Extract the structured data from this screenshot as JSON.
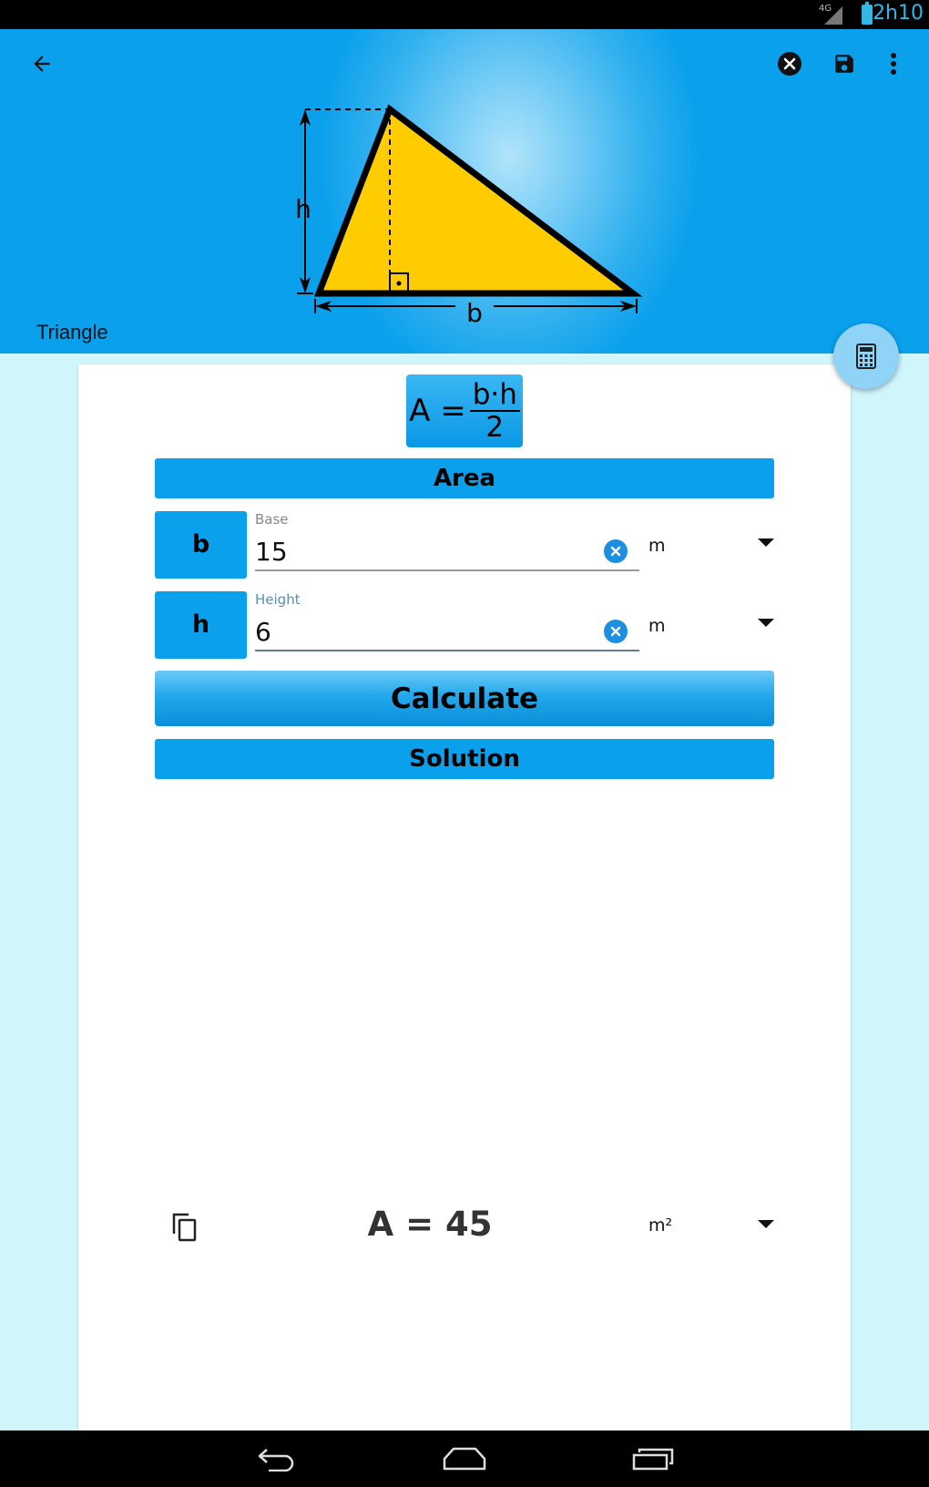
{
  "status_bar": {
    "network_label": "4G",
    "time": "2h10"
  },
  "header": {
    "title": "Triangle",
    "icons": [
      "back-arrow-icon",
      "clear-icon",
      "save-icon",
      "more-vert-icon"
    ],
    "diagram": {
      "height_label": "h",
      "base_label": "b",
      "fill_color": "#FFCC00"
    }
  },
  "fab": {
    "icon": "calculator-icon"
  },
  "formula": {
    "lhs": "A =",
    "numerator": "b·h",
    "denominator": "2"
  },
  "area_section": {
    "label": "Area"
  },
  "inputs": [
    {
      "symbol": "b",
      "label": "Base",
      "value": "15",
      "unit": "m"
    },
    {
      "symbol": "h",
      "label": "Height",
      "value": "6",
      "unit": "m"
    }
  ],
  "calculate_button": {
    "label": "Calculate"
  },
  "solution_section": {
    "label": "Solution"
  },
  "result": {
    "text": "A = 45",
    "unit": "m²"
  },
  "colors": {
    "accent": "#0AA0EC",
    "background": "#CFF6FB",
    "triangle": "#FFCC00",
    "clear_button": "#1D8FE0"
  },
  "nav_bar": {
    "icons": [
      "nav-back-icon",
      "nav-home-icon",
      "nav-recents-icon"
    ]
  }
}
